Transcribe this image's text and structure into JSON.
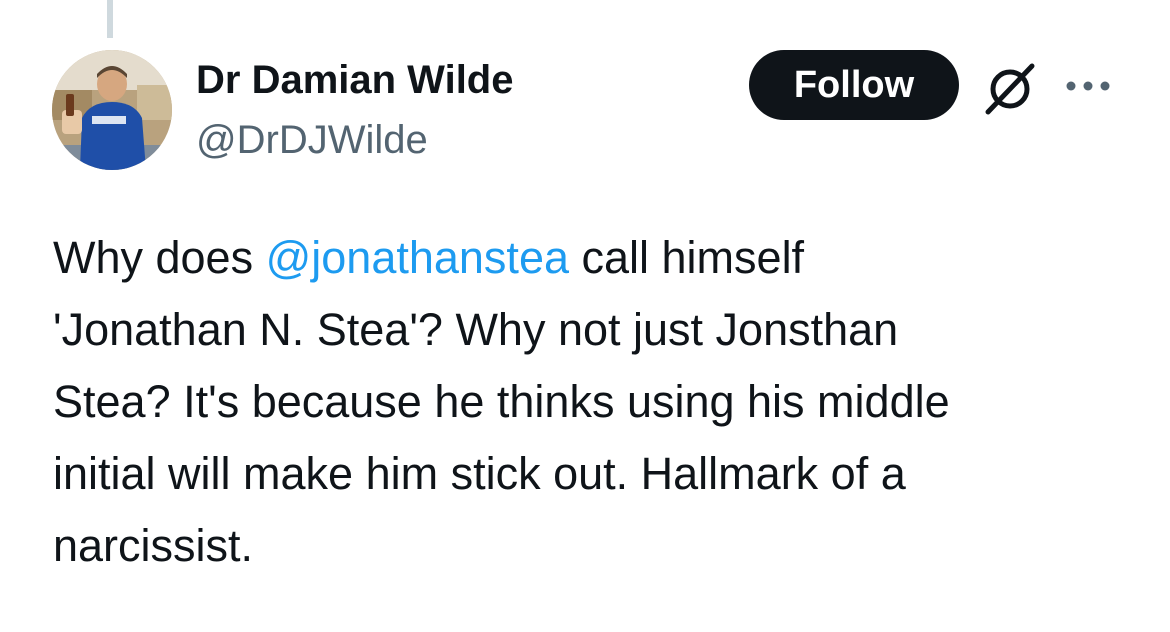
{
  "author": {
    "display_name": "Dr Damian Wilde",
    "handle": "@DrDJWilde",
    "avatar_icon": "profile-photo"
  },
  "actions": {
    "follow_label": "Follow",
    "grok_icon": "grok-icon",
    "more_icon": "more-dots-icon"
  },
  "tweet": {
    "line1_before": "Why does ",
    "mention": "@jonathanstea",
    "line1_after": " call himself",
    "line2": "'Jonathan N. Stea'? Why not just Jonsthan",
    "line3": "Stea? It's because he thinks using his middle",
    "line4": "initial will make him stick out. Hallmark of a",
    "line5": "narcissist."
  },
  "colors": {
    "text": "#0f1419",
    "secondary_text": "#536471",
    "mention": "#1d9bf0",
    "follow_bg": "#0f1419",
    "follow_text": "#ffffff",
    "thread_line": "#cfd9de"
  }
}
